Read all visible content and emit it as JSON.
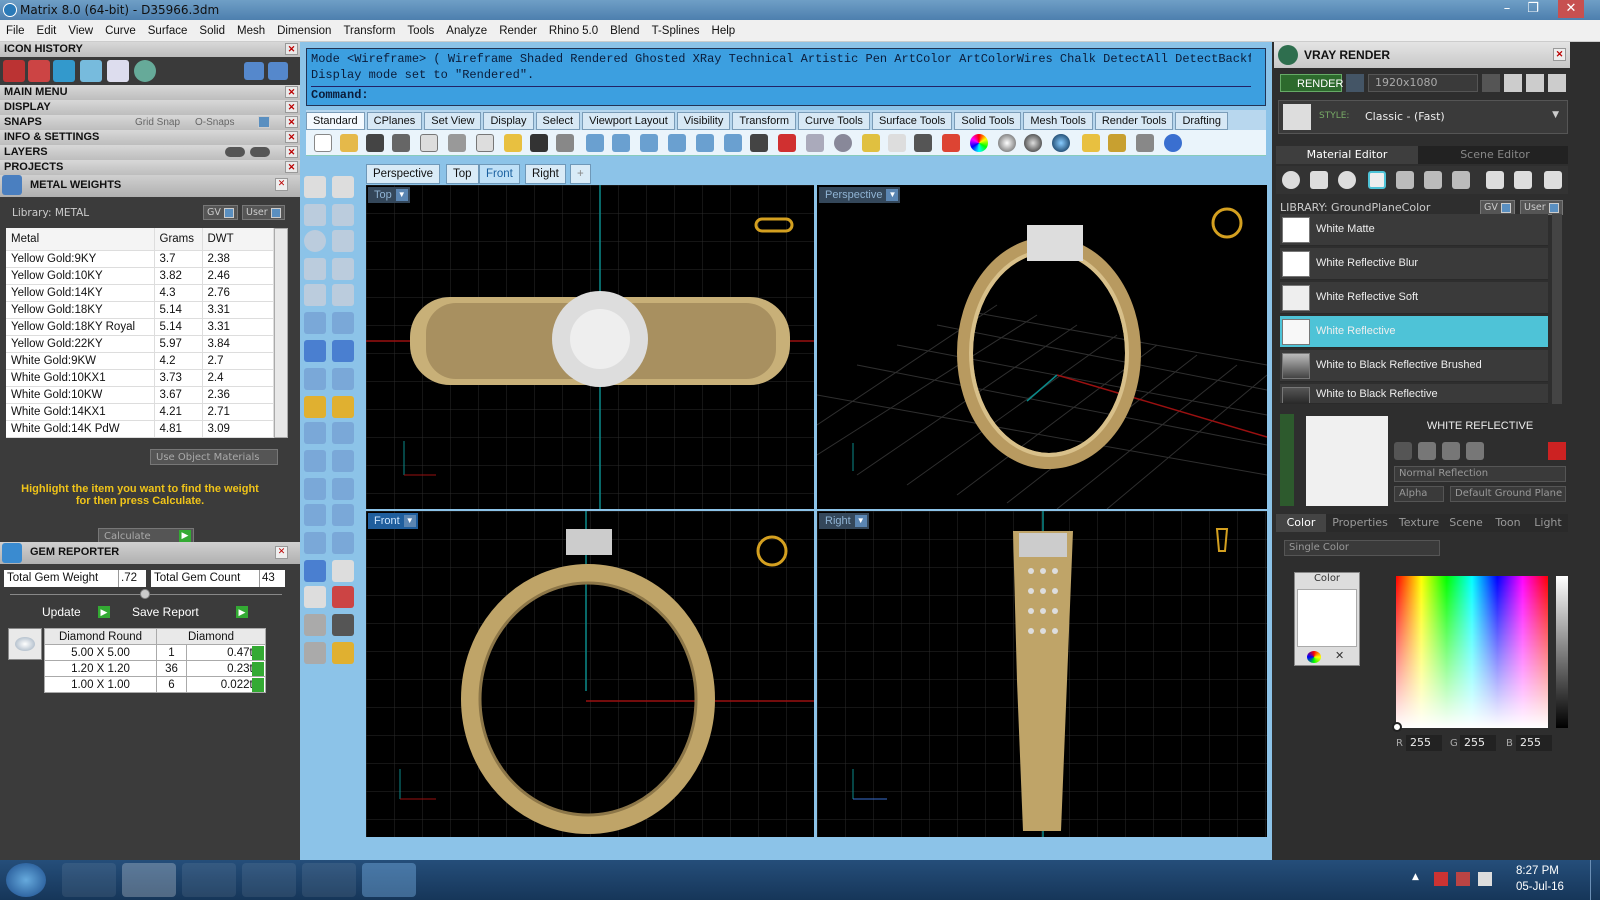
{
  "window": {
    "title": "Matrix 8.0 (64-bit) - D35966.3dm",
    "min": "–",
    "max": "❐",
    "close": "✕"
  },
  "menu": [
    "File",
    "Edit",
    "View",
    "Curve",
    "Surface",
    "Solid",
    "Mesh",
    "Dimension",
    "Transform",
    "Tools",
    "Analyze",
    "Render",
    "Rhino 5.0",
    "Blend",
    "T-Splines",
    "Help"
  ],
  "left": {
    "sections": [
      "ICON HISTORY",
      "MAIN MENU",
      "DISPLAY",
      "SNAPS",
      "INFO & SETTINGS",
      "LAYERS",
      "PROJECTS"
    ],
    "snaps": {
      "grid": "Grid Snap",
      "osnaps": "O-Snaps"
    },
    "metal": {
      "title": "METAL WEIGHTS",
      "library": "Library: METAL",
      "gv": "GV",
      "user": "User",
      "headers": [
        "Metal",
        "Grams",
        "DWT"
      ],
      "rows": [
        [
          "Yellow Gold:9KY",
          "3.7",
          "2.38"
        ],
        [
          "Yellow Gold:10KY",
          "3.82",
          "2.46"
        ],
        [
          "Yellow Gold:14KY",
          "4.3",
          "2.76"
        ],
        [
          "Yellow Gold:18KY",
          "5.14",
          "3.31"
        ],
        [
          "Yellow Gold:18KY Royal",
          "5.14",
          "3.31"
        ],
        [
          "Yellow Gold:22KY",
          "5.97",
          "3.84"
        ],
        [
          "White Gold:9KW",
          "4.2",
          "2.7"
        ],
        [
          "White Gold:10KX1",
          "3.73",
          "2.4"
        ],
        [
          "White Gold:10KW",
          "3.67",
          "2.36"
        ],
        [
          "White Gold:14KX1",
          "4.21",
          "2.71"
        ],
        [
          "White Gold:14K PdW",
          "4.81",
          "3.09"
        ]
      ],
      "use_obj": "Use Object Materials",
      "hint": "Highlight the item you want to find the weight for then press Calculate.",
      "calc": "Calculate"
    },
    "gem": {
      "title": "GEM REPORTER",
      "tw_label": "Total Gem Weight",
      "tw": ".72",
      "tc_label": "Total Gem Count",
      "tc": "43",
      "update": "Update",
      "save": "Save Report",
      "headers": [
        "Diamond Round",
        "Diamond"
      ],
      "rows": [
        [
          "5.00 X 5.00",
          "1",
          "0.47tw"
        ],
        [
          "1.20 X 1.20",
          "36",
          "0.23tw"
        ],
        [
          "1.00 X 1.00",
          "6",
          "0.022tw"
        ]
      ]
    }
  },
  "cmd": {
    "line1": "Mode <Wireframe> ( Wireframe  Shaded  Rendered  Ghosted  XRay  Technical  Artistic  Pen  ArtColor  ArtColorWires  Chalk  DetectAll  DetectBackfaces  DetectNake",
    "line2": "Display mode set to \"Rendered\".",
    "line3": "Command:"
  },
  "toolbar_tabs": [
    "Standard",
    "CPlanes",
    "Set View",
    "Display",
    "Select",
    "Viewport Layout",
    "Visibility",
    "Transform",
    "Curve Tools",
    "Surface Tools",
    "Solid Tools",
    "Mesh Tools",
    "Render Tools",
    "Drafting"
  ],
  "view_tabs": [
    "Perspective",
    "Top",
    "Front",
    "Right",
    "+"
  ],
  "viewports": {
    "top": "Top",
    "persp": "Perspective",
    "front": "Front",
    "right": "Right"
  },
  "right": {
    "title": "VRAY RENDER",
    "render": "RENDER",
    "res": "1920x1080",
    "style_label": "STYLE:",
    "style": "Classic - (Fast)",
    "tabs": [
      "Material Editor",
      "Scene Editor"
    ],
    "library": "LIBRARY: GroundPlaneColor",
    "gv": "GV",
    "user": "User",
    "materials": [
      "White Matte",
      "White Reflective Blur",
      "White Reflective Soft",
      "White Reflective",
      "White to Black Reflective Brushed",
      "White to Black Reflective"
    ],
    "selected_name": "WHITE REFLECTIVE",
    "normal": "Normal Reflection",
    "alpha": "Alpha",
    "default_ground": "Default Ground Plane",
    "sub_tabs": [
      "Color",
      "Properties",
      "Texture",
      "Scene",
      "Toon",
      "Light"
    ],
    "single": "Single Color",
    "color_label": "Color",
    "r": "R",
    "g": "G",
    "b": "B",
    "rv": "255",
    "gv_val": "255",
    "bv": "255"
  },
  "taskbar": {
    "time": "8:27 PM",
    "date": "05-Jul-16"
  }
}
